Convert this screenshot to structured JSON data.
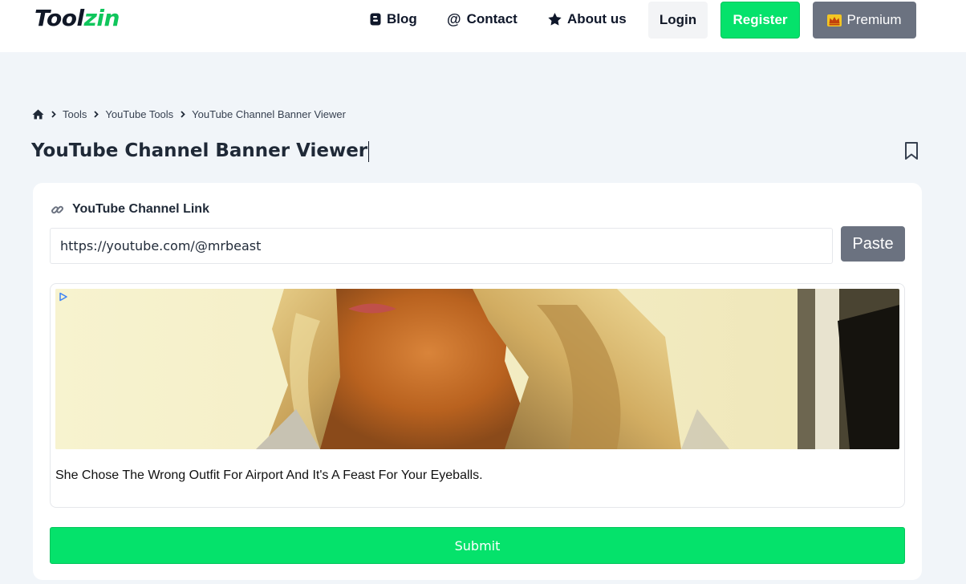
{
  "header": {
    "logo_part1": "Tool",
    "logo_part2": "zin",
    "nav": {
      "blog": "Blog",
      "contact": "Contact",
      "about": "About us"
    },
    "login": "Login",
    "register": "Register",
    "premium": "Premium"
  },
  "breadcrumb": {
    "home_icon": "home-icon",
    "items": [
      "Tools",
      "YouTube Tools",
      "YouTube Channel Banner Viewer"
    ]
  },
  "page": {
    "title": "YouTube Channel Banner Viewer"
  },
  "form": {
    "label": "YouTube Channel Link",
    "input_value": "https://youtube.com/@mrbeast",
    "paste_label": "Paste",
    "submit_label": "Submit"
  },
  "ad": {
    "headline": "She Chose The Wrong Outfit For Airport And It's A Feast For Your Eyeballs."
  },
  "colors": {
    "brand_green": "#05e26b",
    "logo_green": "#10c65c",
    "gray_button": "#6b7280",
    "page_bg": "#f1f5f9"
  }
}
